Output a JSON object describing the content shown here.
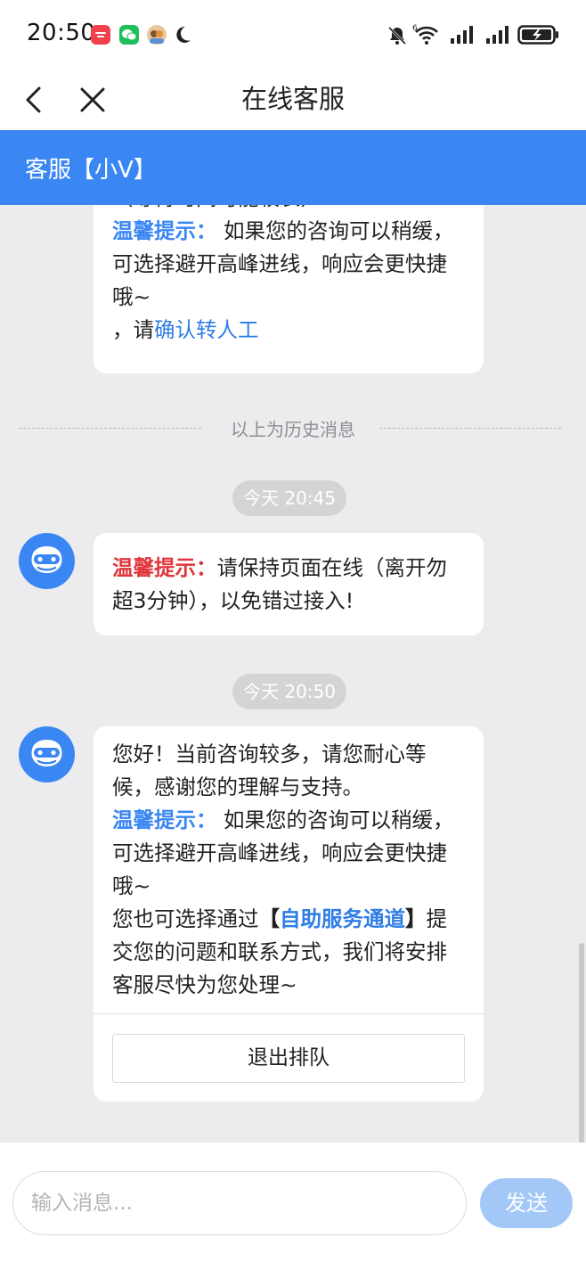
{
  "status_bar": {
    "time": "20:50",
    "icons": [
      "app-notification-icon",
      "wechat-icon",
      "avatar-notification-icon",
      "moon-icon",
      "mute-bell-icon",
      "wifi-6-icon",
      "signal-icon",
      "signal-icon",
      "battery-charging-icon"
    ]
  },
  "nav": {
    "title": "在线客服",
    "back_icon": "chevron-left-icon",
    "close_icon": "close-icon"
  },
  "agent_bar": {
    "name": "客服【小V】"
  },
  "history": {
    "partial_message": {
      "line_top": "（等待时间可能较长）",
      "tip_label": "温馨提示：",
      "tip_text": " 如果您的咨询可以稍缓，可选择避开高峰进线，响应会更快捷哦~",
      "confirm_prefix": "，请",
      "confirm_link": "确认转人工"
    },
    "divider_label": "以上为历史消息"
  },
  "messages": [
    {
      "time": "今天 20:45",
      "tip_label": "温馨提示：",
      "text": "请保持页面在线（离开勿超3分钟），以免错过接入!"
    },
    {
      "time": "今天 20:50",
      "text1": "您好！当前咨询较多，请您耐心等候，感谢您的理解与支持。",
      "tip_label": "温馨提示：",
      "tip_text": " 如果您的咨询可以稍缓，可选择避开高峰进线，响应会更快捷哦~",
      "text2_prefix": "您也可选择通过",
      "bracket_open": "【",
      "self_service_link": "自助服务通道",
      "bracket_close": "】",
      "text2_suffix": "提交您的问题和联系方式，我们将安排客服尽快为您处理~",
      "exit_button": "退出排队"
    }
  ],
  "input": {
    "placeholder": "输入消息...",
    "value": "",
    "send_label": "发送"
  },
  "colors": {
    "brand_blue": "#3a86f3",
    "tip_red": "#e0363c",
    "send_disabled": "#a3c7f7",
    "chat_bg": "#ececee"
  }
}
